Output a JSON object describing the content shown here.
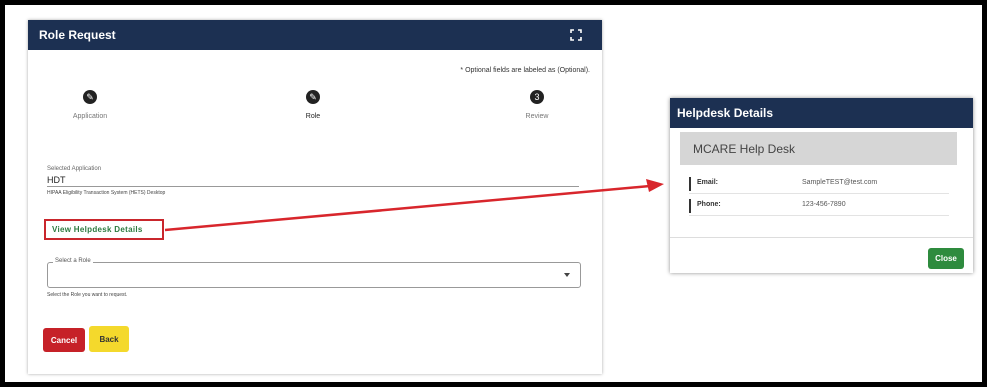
{
  "role_request": {
    "title": "Role Request",
    "optional_note": "* Optional fields are labeled as (Optional).",
    "steps": [
      {
        "label": "Application",
        "icon": "pencil-icon"
      },
      {
        "label": "Role",
        "icon": "pencil-icon"
      },
      {
        "label": "Review",
        "icon": "number-icon",
        "number": "3"
      }
    ],
    "selected_application_label": "Selected Application",
    "selected_application_value": "HDT",
    "selected_application_hint": "HIPAA Eligibility Transaction System (HETS) Desktop",
    "helpdesk_link": "View Helpdesk Details",
    "role_select_label": "Select a Role",
    "role_select_hint": "Select the Role you want to request.",
    "cancel_label": "Cancel",
    "back_label": "Back"
  },
  "helpdesk_modal": {
    "title": "Helpdesk Details",
    "desk_name": "MCARE Help Desk",
    "email_label": "Email:",
    "email_value": "SampleTEST@test.com",
    "phone_label": "Phone:",
    "phone_value": "123-456-7890",
    "close_label": "Close"
  },
  "colors": {
    "header_navy": "#1c3052",
    "cancel_red": "#c62128",
    "back_yellow": "#f4d92c",
    "close_green": "#2e8b3e",
    "link_green": "#2c7a3f",
    "highlight_red": "#d8262c"
  }
}
